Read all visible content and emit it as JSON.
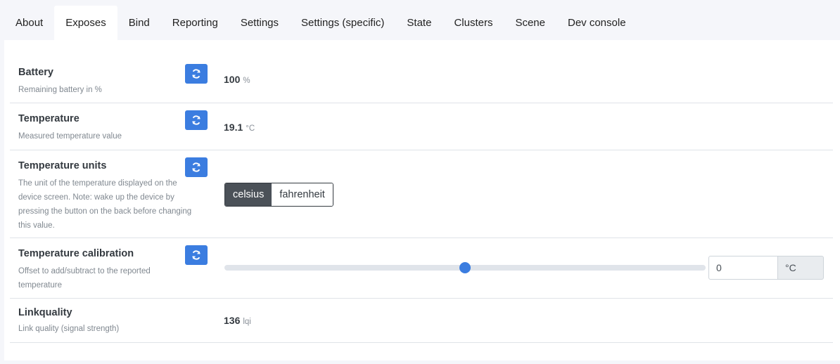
{
  "tabs": [
    {
      "label": "About"
    },
    {
      "label": "Exposes"
    },
    {
      "label": "Bind"
    },
    {
      "label": "Reporting"
    },
    {
      "label": "Settings"
    },
    {
      "label": "Settings (specific)"
    },
    {
      "label": "State"
    },
    {
      "label": "Clusters"
    },
    {
      "label": "Scene"
    },
    {
      "label": "Dev console"
    }
  ],
  "active_tab": "Exposes",
  "accent_color": "#3b7de0",
  "refresh_icon": "sync-icon",
  "exposes": {
    "battery": {
      "name": "Battery",
      "description": "Remaining battery in %",
      "value": "100",
      "unit": "%"
    },
    "temperature": {
      "name": "Temperature",
      "description": "Measured temperature value",
      "value": "19.1",
      "unit": "°C"
    },
    "temperature_units": {
      "name": "Temperature units",
      "description": "The unit of the temperature displayed on the device screen. Note: wake up the device by pressing the button on the back before changing this value.",
      "options": [
        "celsius",
        "fahrenheit"
      ],
      "selected": "celsius"
    },
    "temperature_calibration": {
      "name": "Temperature calibration",
      "description": "Offset to add/subtract to the reported temperature",
      "value": "0",
      "unit": "°C",
      "slider_fraction": 0.5
    },
    "linkquality": {
      "name": "Linkquality",
      "description": "Link quality (signal strength)",
      "value": "136",
      "unit": "lqi"
    }
  }
}
